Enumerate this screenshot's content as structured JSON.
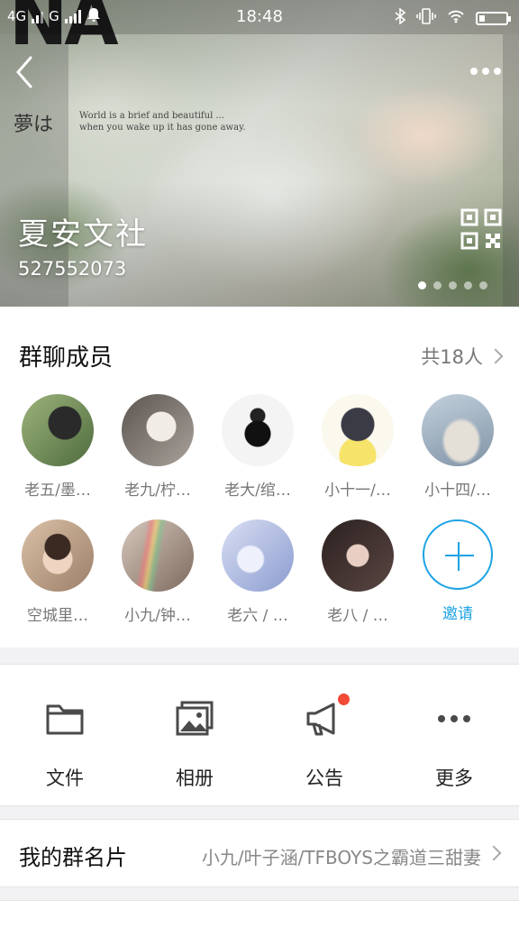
{
  "status_bar": {
    "network1": "4G",
    "network2": "G",
    "time": "18:48"
  },
  "cover": {
    "brand_text": "NA",
    "jp_text": "夢は",
    "script_text": "World is a brief and beautiful ... when you wake up it has gone away.",
    "group_name": "夏安文社",
    "group_id": "527552073",
    "page_dots": 5,
    "active_dot": 1
  },
  "members_section": {
    "title": "群聊成员",
    "count_label": "共18人",
    "members": [
      {
        "name": "老五/墨…",
        "color": "#6f8a5a"
      },
      {
        "name": "老九/柠…",
        "color": "#7a6a62"
      },
      {
        "name": "老大/绾…",
        "color": "#e9e9e9"
      },
      {
        "name": "小十一/…",
        "color": "#f3efe1"
      },
      {
        "name": "小十四/…",
        "color": "#a8b9c9"
      },
      {
        "name": "空城里…",
        "color": "#c9a98f"
      },
      {
        "name": "小九/钟…",
        "color": "#b49a8c"
      },
      {
        "name": "老六 / …",
        "color": "#b8c4df"
      },
      {
        "name": "老八 / …",
        "color": "#3a2d2a"
      }
    ],
    "invite_label": "邀请"
  },
  "tools": [
    {
      "label": "文件",
      "icon": "folder-icon"
    },
    {
      "label": "相册",
      "icon": "album-icon"
    },
    {
      "label": "公告",
      "icon": "megaphone-icon"
    },
    {
      "label": "更多",
      "icon": "more-icon"
    }
  ],
  "group_card": {
    "label": "我的群名片",
    "value": "小九/叶子涵/TFBOYS之霸道三甜妻"
  },
  "colors": {
    "accent": "#1ba3e4",
    "notice_dot": "#f24a36"
  }
}
